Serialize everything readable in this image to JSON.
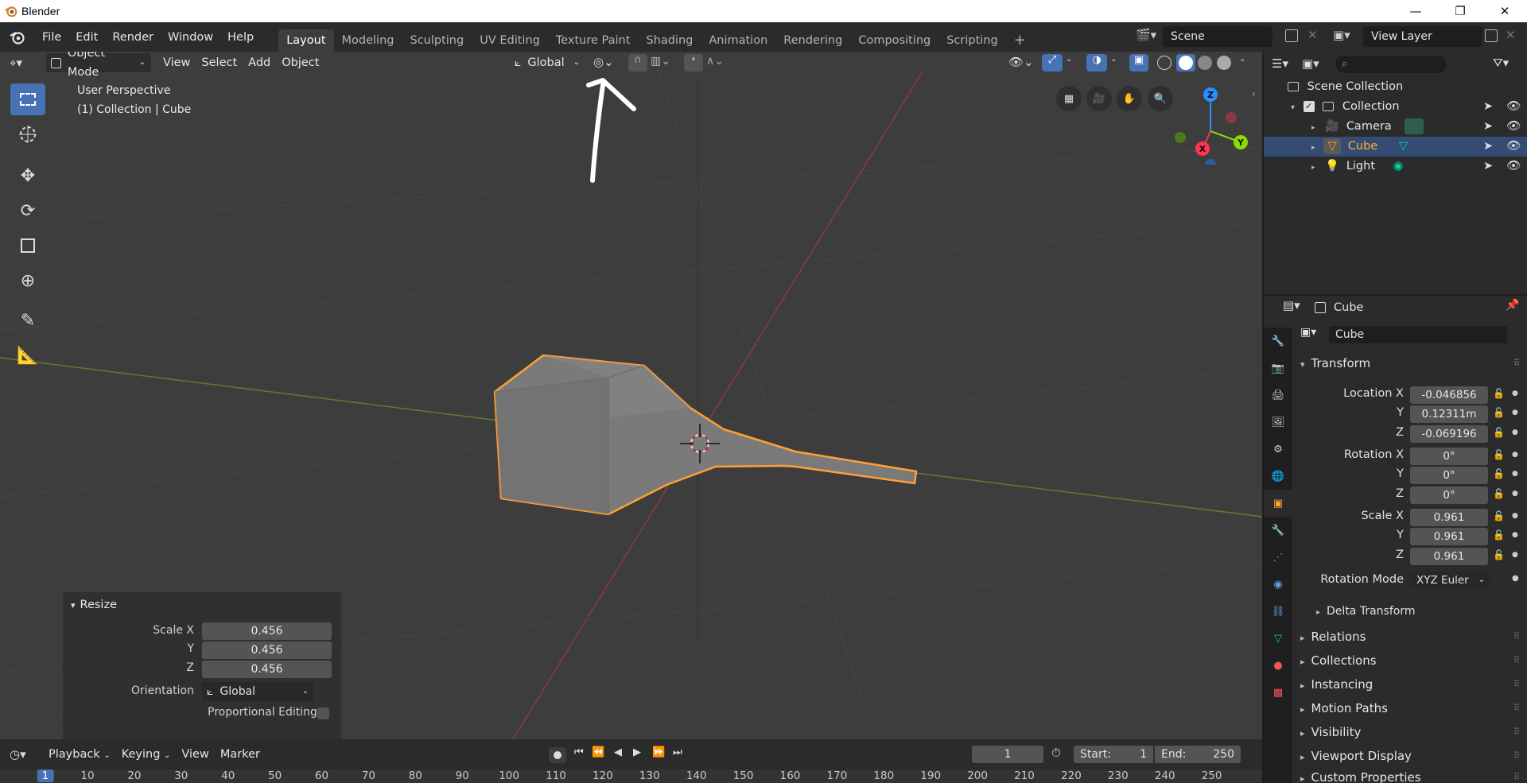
{
  "window": {
    "title": "Blender"
  },
  "topbar": {
    "menus": [
      "File",
      "Edit",
      "Render",
      "Window",
      "Help"
    ],
    "workspaces": [
      "Layout",
      "Modeling",
      "Sculpting",
      "UV Editing",
      "Texture Paint",
      "Shading",
      "Animation",
      "Rendering",
      "Compositing",
      "Scripting"
    ],
    "active_workspace": "Layout",
    "scene": "Scene",
    "view_layer": "View Layer"
  },
  "viewport": {
    "mode": "Object Mode",
    "menus": [
      "View",
      "Select",
      "Add",
      "Object"
    ],
    "orientation": "Global",
    "perspective_label": "User Perspective",
    "collection_label": "(1) Collection | Cube",
    "gizmo_axes": [
      "Z",
      "Y",
      "X"
    ]
  },
  "resize_panel": {
    "title": "Resize",
    "scale_label": "Scale X",
    "y_label": "Y",
    "z_label": "Z",
    "scale_x": "0.456",
    "scale_y": "0.456",
    "scale_z": "0.456",
    "orientation_label": "Orientation",
    "orientation": "Global",
    "proportional_label": "Proportional Editing"
  },
  "timeline": {
    "menus": [
      "Playback",
      "Keying",
      "View",
      "Marker"
    ],
    "current_frame": "1",
    "start_label": "Start:",
    "start": "1",
    "end_label": "End:",
    "end": "250",
    "ruler": [
      "1",
      "10",
      "20",
      "30",
      "40",
      "50",
      "60",
      "70",
      "80",
      "90",
      "100",
      "110",
      "120",
      "130",
      "140",
      "150",
      "160",
      "170",
      "180",
      "190",
      "200",
      "210",
      "220",
      "230",
      "240",
      "250"
    ]
  },
  "outliner": {
    "root": "Scene Collection",
    "collection": "Collection",
    "items": [
      "Camera",
      "Cube",
      "Light"
    ],
    "selected": "Cube"
  },
  "properties": {
    "object_name": "Cube",
    "datablock_name": "Cube",
    "transform_title": "Transform",
    "location_label": "Location X",
    "rotation_label": "Rotation X",
    "scale_label": "Scale X",
    "y_label": "Y",
    "z_label": "Z",
    "location": [
      "-0.046856",
      "0.12311m",
      "-0.069196"
    ],
    "rotation": [
      "0°",
      "0°",
      "0°"
    ],
    "scale": [
      "0.961",
      "0.961",
      "0.961"
    ],
    "rotation_mode_label": "Rotation Mode",
    "rotation_mode": "XYZ Euler",
    "delta_transform": "Delta Transform",
    "sections": [
      "Relations",
      "Collections",
      "Instancing",
      "Motion Paths",
      "Visibility",
      "Viewport Display",
      "Custom Properties"
    ]
  },
  "colors": {
    "accent": "#4772b3",
    "selection": "#ffa033",
    "axis_x": "#ff3352",
    "axis_y": "#8bdc00",
    "axis_z": "#2890ff"
  }
}
